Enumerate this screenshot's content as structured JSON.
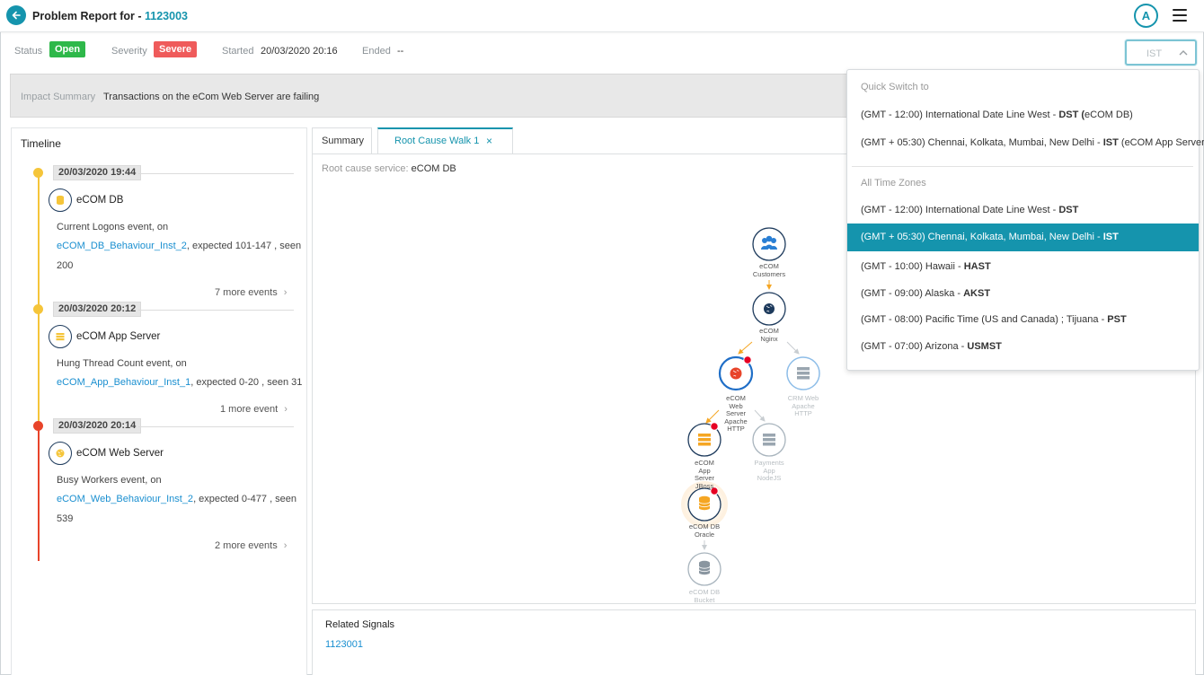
{
  "header": {
    "title_prefix": "Problem Report for - ",
    "problem_id": "1123003",
    "avatar_letter": "A"
  },
  "status": {
    "status_label": "Status",
    "status_value": "Open",
    "severity_label": "Severity",
    "severity_value": "Severe",
    "started_label": "Started",
    "started_value": "20/03/2020 20:16",
    "ended_label": "Ended",
    "ended_value": "--",
    "timezone_value": "IST"
  },
  "impact": {
    "label": "Impact Summary",
    "text": "Transactions on the eCom Web Server are failing"
  },
  "timeline": {
    "title": "Timeline",
    "events": [
      {
        "date": "20/03/2020 19:44",
        "service": "eCOM DB",
        "event_text": "Current Logons  event, on",
        "link": "eCOM_DB_Behaviour_Inst_2",
        "detail": ", expected 101-147 , seen",
        "detail2": "200",
        "more": "7 more events"
      },
      {
        "date": "20/03/2020 20:12",
        "service": "eCOM App Server",
        "event_text": "Hung Thread Count  event, on",
        "link": "eCOM_App_Behaviour_Inst_1",
        "detail": ", expected 0-20 , seen 31",
        "more": "1 more event"
      },
      {
        "date": "20/03/2020 20:14",
        "service": "eCOM Web Server",
        "event_text": "Busy Workers  event, on",
        "link": "eCOM_Web_Behaviour_Inst_2",
        "detail": ", expected 0-477 , seen",
        "detail2": "539",
        "more": "2 more events"
      }
    ]
  },
  "tabs": {
    "summary": "Summary",
    "root_cause": "Root Cause Walk 1",
    "close": "×"
  },
  "root_cause": {
    "label": "Root cause service: ",
    "value": "eCOM DB"
  },
  "graph_nodes": {
    "customers": [
      "eCOM",
      "Customers"
    ],
    "nginx": [
      "eCOM",
      "Nginx"
    ],
    "web": [
      "eCOM",
      "Web",
      "Server",
      "Apache",
      "HTTP"
    ],
    "crm": [
      "CRM Web",
      "Apache",
      "HTTP"
    ],
    "app": [
      "eCOM",
      "App",
      "Server",
      "JBoss"
    ],
    "payments": [
      "Payments",
      "App",
      "NodeJS"
    ],
    "db": [
      "eCOM DB",
      "Oracle"
    ],
    "bucket": [
      "eCOM DB",
      "Bucket"
    ]
  },
  "related": {
    "title": "Related Signals",
    "link": "1123001"
  },
  "dropdown": {
    "quick_head": "Quick Switch to",
    "quick_items": [
      {
        "prefix": "(GMT - 12:00) International Date Line West - ",
        "abbr": "DST",
        "suffix": " (",
        "bold2": "",
        "tail": "eCOM DB)"
      },
      {
        "prefix": "(GMT + 05:30) Chennai, Kolkata, Mumbai, New Delhi - ",
        "abbr": "IST",
        "suffix": " (eCOM App Server)",
        "tail": ""
      }
    ],
    "all_head": "All Time Zones",
    "all_items": [
      {
        "prefix": "(GMT - 12:00) International Date Line West - ",
        "abbr": "DST"
      },
      {
        "prefix": "(GMT + 05:30) Chennai, Kolkata, Mumbai, New Delhi - ",
        "abbr": "IST"
      },
      {
        "prefix": "(GMT - 10:00) Hawaii - ",
        "abbr": "HAST"
      },
      {
        "prefix": "(GMT - 09:00) Alaska - ",
        "abbr": "AKST"
      },
      {
        "prefix": "(GMT - 08:00) Pacific Time (US and Canada) ; Tijuana - ",
        "abbr": "PST"
      },
      {
        "prefix": "(GMT - 07:00) Arizona - ",
        "abbr": "USMST"
      }
    ]
  },
  "colors": {
    "accent": "#1594ad",
    "open": "#2eb84a",
    "severe": "#ef5b5b",
    "warn": "#f5c53a",
    "danger": "#e8442a"
  }
}
